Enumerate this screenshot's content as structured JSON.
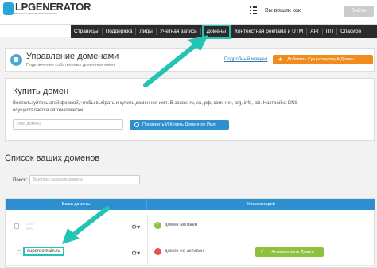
{
  "header": {
    "logo_text": "LPGENERATOR",
    "logo_sub": "технология привлечения клиентов",
    "login_text": "Вы вошли как",
    "enter_label": "Войти"
  },
  "nav": {
    "items": [
      "Страницы",
      "Поддержка",
      "Лиды",
      "Учетная запись",
      "Домены",
      "Контекстная реклама и UTM",
      "API",
      "ПП",
      "Спасибо"
    ],
    "active_index": 4
  },
  "domains_panel": {
    "title": "Управление доменами",
    "subtitle": "Подключение собственных доменных имен",
    "manual_link": "Подробный мануал",
    "add_button": "Добавить Существующий Домен"
  },
  "buy_panel": {
    "title": "Купить домен",
    "description": "Воспользуйтесь этой формой, чтобы выбрать и купить доменное имя. В зонах: ru, su, рф, com, net, org, info, biz. Настройка DNS осуществляется автоматически.",
    "input_placeholder": "Имя домена",
    "buy_button": "Проверить И Купить Доменное Имя"
  },
  "list": {
    "title": "Список ваших доменов",
    "search_label": "Поиск:",
    "search_placeholder": "Быстрое название домена",
    "columns": [
      "Ваши домены",
      "Комментарий"
    ],
    "rows": [
      {
        "domain": "",
        "status": "домен активен",
        "status_type": "ok"
      },
      {
        "domain": "superdomain.ru",
        "status": "домен не активен",
        "status_type": "bad",
        "action": "Активировать Домен"
      }
    ]
  },
  "colors": {
    "accent": "#2d8fd0",
    "highlight": "#23c4b4",
    "orange": "#f08c1e",
    "green": "#8dc13e",
    "red": "#e0534a"
  }
}
